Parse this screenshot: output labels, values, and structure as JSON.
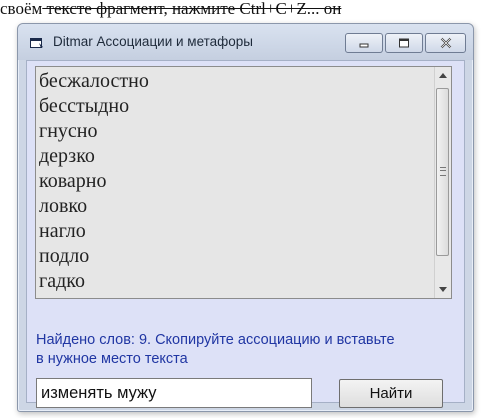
{
  "background_document": {
    "text_visible": "своём тексте фрагмент, нажмите Ctrl+C+Z... он",
    "text_lead": "своём",
    "text_rest": " тексте фрагмент, нажмите Ctrl+C+Z... он"
  },
  "window": {
    "title": "Ditmar Ассоциации и метафоры",
    "controls": {
      "minimize": "minimize",
      "maximize": "maximize",
      "close": "close"
    }
  },
  "list": {
    "items": [
      "бесжалостно",
      "бесстыдно",
      "гнусно",
      "дерзко",
      "коварно",
      "ловко",
      "нагло",
      "подло",
      "гадко"
    ]
  },
  "status": {
    "text": "Найдено слов:  9. Скопируйте ассоциацию и вставьте в нужное место текста"
  },
  "search": {
    "value": "изменять мужу"
  },
  "find_button": {
    "label": "Найти"
  },
  "colors": {
    "status_text": "#2036a3",
    "client_bg": "#dde1f7",
    "frame_bg": "#cdd6e5"
  }
}
